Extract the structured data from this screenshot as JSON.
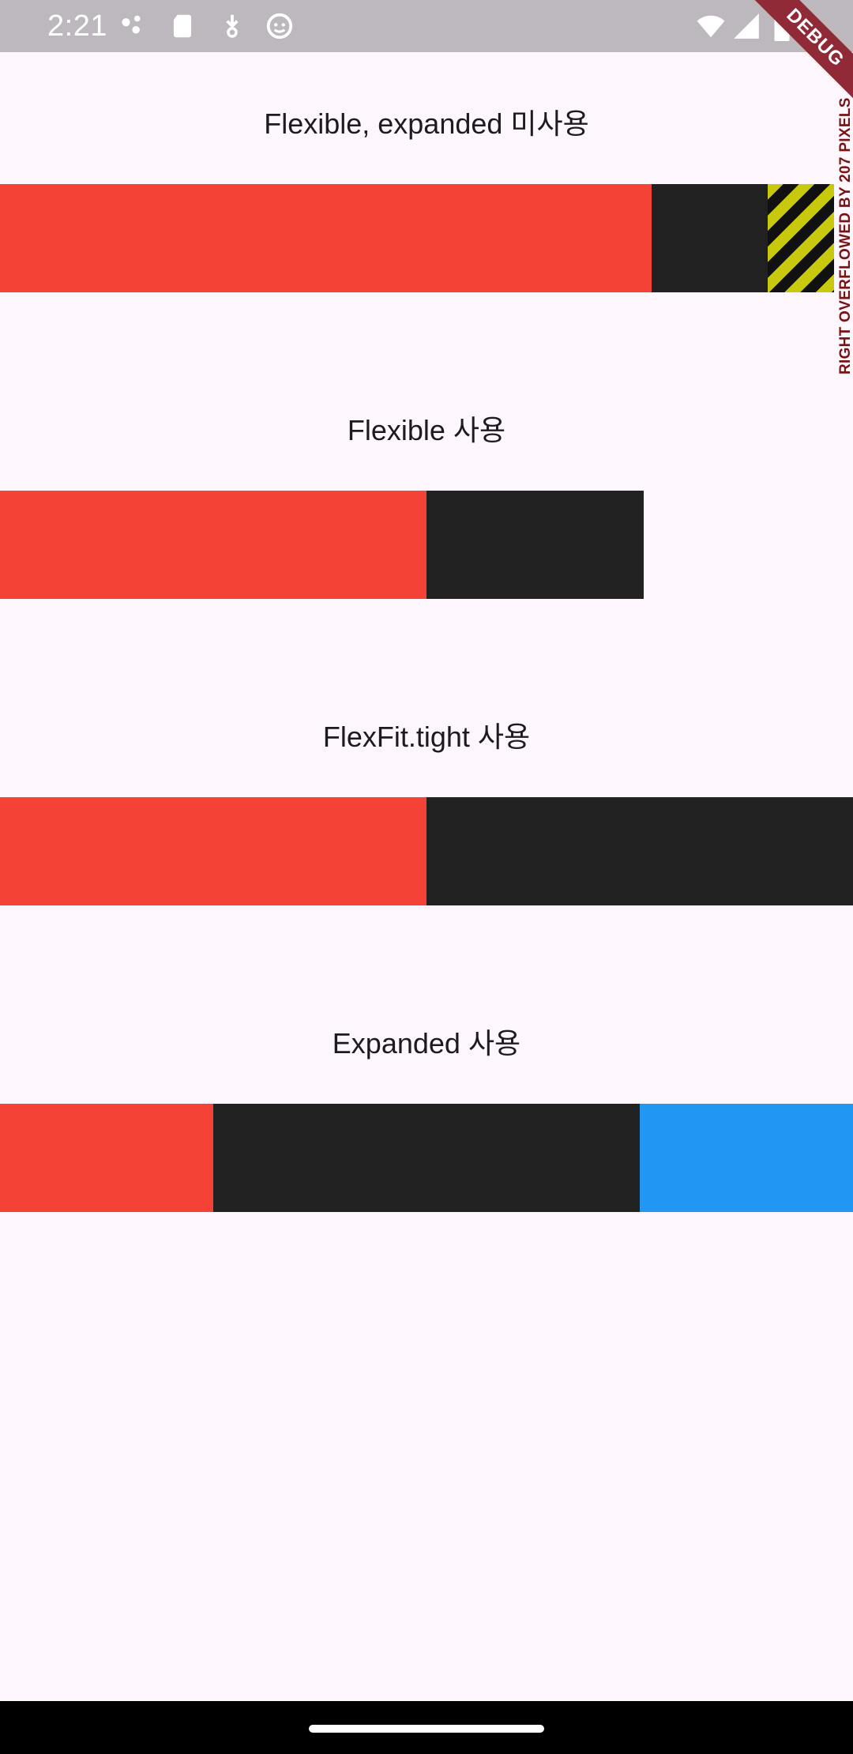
{
  "status_bar": {
    "time": "2:21",
    "icons": [
      "dots-icon",
      "sd-card-icon",
      "download-icon",
      "face-icon",
      "wifi-icon",
      "signal-icon",
      "battery-icon"
    ]
  },
  "debug_banner": {
    "label": "DEBUG"
  },
  "overflow_warning": {
    "text": "RIGHT OVERFLOWED BY 207 PIXELS"
  },
  "sections": [
    {
      "title": "Flexible, expanded 미사용"
    },
    {
      "title": "Flexible 사용"
    },
    {
      "title": "FlexFit.tight 사용"
    },
    {
      "title": "Expanded 사용"
    }
  ],
  "colors": {
    "red": "#f44336",
    "dark": "#212121",
    "blue": "#2196f3",
    "background": "#fdf7fd",
    "overflow_stripe": "#c8c80c"
  }
}
